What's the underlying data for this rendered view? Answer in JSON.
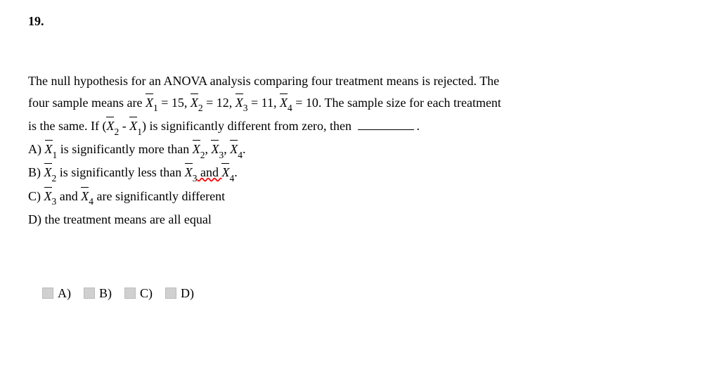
{
  "question": {
    "number": "19.",
    "line1_a": "The null hypothesis for an ANOVA analysis comparing four treatment means is rejected. The",
    "line2_a": "four sample means are ",
    "x1": "X",
    "sub1": "1",
    "eq1": " = 15, ",
    "x2": "X",
    "sub2": "2",
    "eq2": " = 12, ",
    "x3": "X",
    "sub3": "3",
    "eq3": " = 11, ",
    "x4": "X",
    "sub4": "4",
    "eq4": " = 10. The sample size for each treatment",
    "line3_a": "is the same. If (",
    "diff_x2": "X",
    "diff_sub2": "2",
    "minus": " - ",
    "diff_x1": "X",
    "diff_sub1": "1",
    "line3_b": ") is significantly different from zero, then ",
    "period": ".",
    "optA_label": "A) ",
    "optA_x1": "X",
    "optA_s1": "1",
    "optA_text": " is significantly more than ",
    "optA_x2": "X",
    "optA_s2": "2",
    "optA_comma1": ", ",
    "optA_x3": "X",
    "optA_s3": "3",
    "optA_comma2": ", ",
    "optA_x4": "X",
    "optA_s4": "4",
    "optA_end": ".",
    "optB_label": "B) ",
    "optB_x2": "X",
    "optB_s2": "2",
    "optB_text": " is significantly less than ",
    "optB_x3": "X",
    "optB_s3": "3",
    "optB_and": " and ",
    "optB_x4": "X",
    "optB_s4": "4",
    "optB_end": ".",
    "optC_label": "C) ",
    "optC_x3": "X",
    "optC_s3": "3",
    "optC_and": " and ",
    "optC_x4": "X",
    "optC_s4": "4",
    "optC_text": " are significantly different",
    "optD_label": "D) ",
    "optD_text": "the treatment means are all equal"
  },
  "answers": {
    "A": "A)",
    "B": "B)",
    "C": "C)",
    "D": "D)"
  }
}
